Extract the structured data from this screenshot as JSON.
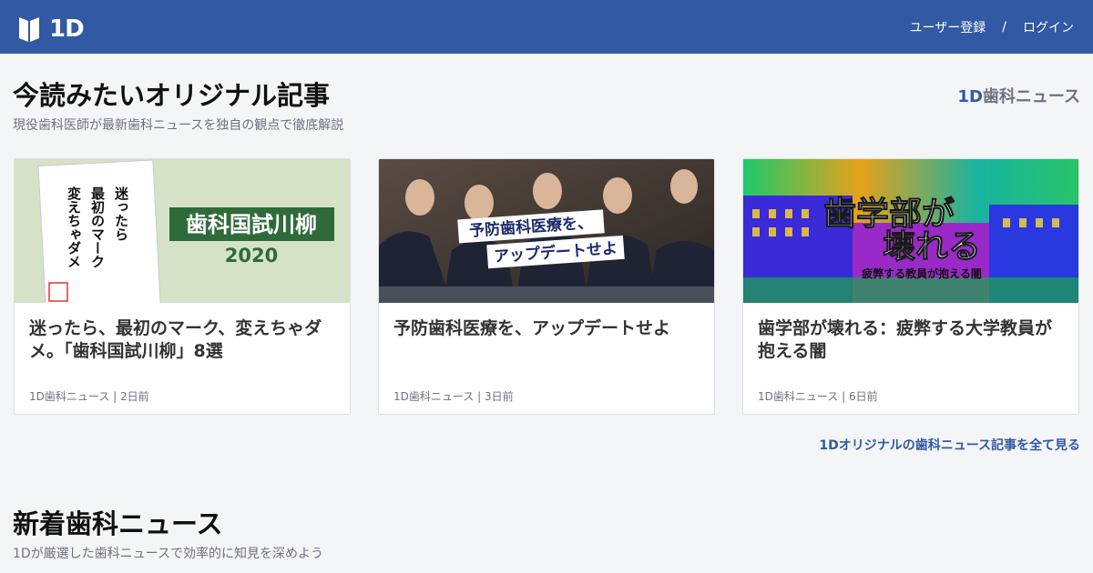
{
  "header": {
    "logo_text": "1D",
    "nav": {
      "register": "ユーザー登録",
      "separator": "/",
      "login": "ログイン"
    },
    "bg_color": "#3159a4"
  },
  "originals": {
    "title": "今読みたいオリジナル記事",
    "subtitle": "現役歯科医師が最新歯科ニュースを独自の観点で徹底解説",
    "brand_1d": "1D",
    "brand_text": "歯科ニュース",
    "cards": [
      {
        "title": "迷ったら、最初のマーク、変えちゃダメ。「歯科国試川柳」8選",
        "source": "1D歯科ニュース",
        "date": "2日前",
        "thumb": {
          "poem_col1": "迷ったら",
          "poem_col2": "最初のマーク",
          "poem_col3": "変えちゃダメ",
          "banner": "歯科国試川柳",
          "year": "2020"
        }
      },
      {
        "title": "予防歯科医療を、アップデートせよ",
        "source": "1D歯科ニュース",
        "date": "3日前",
        "thumb": {
          "line1": "予防歯科医療を、",
          "line2": "アップデートせよ"
        }
      },
      {
        "title": "歯学部が壊れる：疲弊する大学教員が抱える闇",
        "source": "1D歯科ニュース",
        "date": "6日前",
        "thumb": {
          "line1": "歯学部が",
          "line2": "壊れる",
          "caption": "疲弊する教員が抱える闇"
        }
      }
    ],
    "more_link": "1Dオリジナルの歯科ニュース記事を全て見る"
  },
  "news": {
    "title": "新着歯科ニュース",
    "subtitle": "1Dが厳選した歯科ニュースで効率的に知見を深めよう"
  }
}
